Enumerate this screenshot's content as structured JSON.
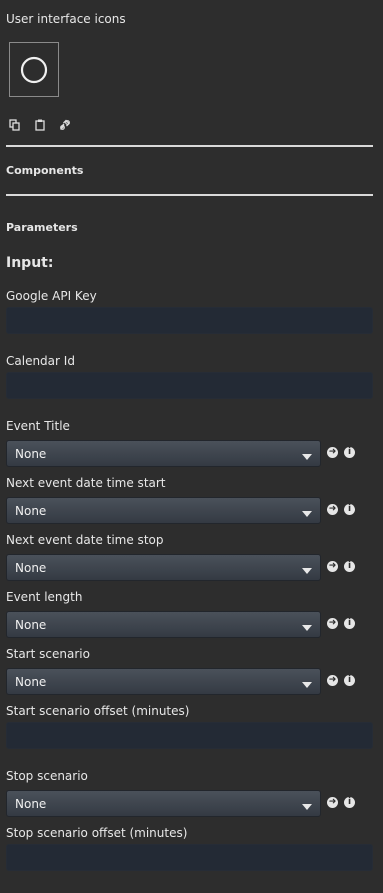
{
  "header": {
    "ui_icons_title": "User interface icons",
    "preview_icon": "circle-icon",
    "toolbar_icons": [
      "copy-icon",
      "paste-icon",
      "link-icon"
    ]
  },
  "sections": {
    "components": "Components",
    "parameters": "Parameters"
  },
  "input_heading": "Input:",
  "fields": {
    "google_api_key": {
      "label": "Google API Key",
      "value": ""
    },
    "calendar_id": {
      "label": "Calendar Id",
      "value": ""
    },
    "event_title": {
      "label": "Event Title",
      "value": "None"
    },
    "next_start": {
      "label": "Next event date time start",
      "value": "None"
    },
    "next_stop": {
      "label": "Next event date time stop",
      "value": "None"
    },
    "event_length": {
      "label": "Event length",
      "value": "None"
    },
    "start_scenario": {
      "label": "Start scenario",
      "value": "None"
    },
    "start_offset": {
      "label": "Start scenario offset (minutes)",
      "value": ""
    },
    "stop_scenario": {
      "label": "Stop scenario",
      "value": "None"
    },
    "stop_offset": {
      "label": "Stop scenario offset (minutes)",
      "value": ""
    }
  },
  "colors": {
    "background": "#2d2d2d",
    "input_bg": "#232a35",
    "select_gradient_top": "#4a515a",
    "select_gradient_bottom": "#343a43",
    "divider": "#d9d9d9"
  }
}
